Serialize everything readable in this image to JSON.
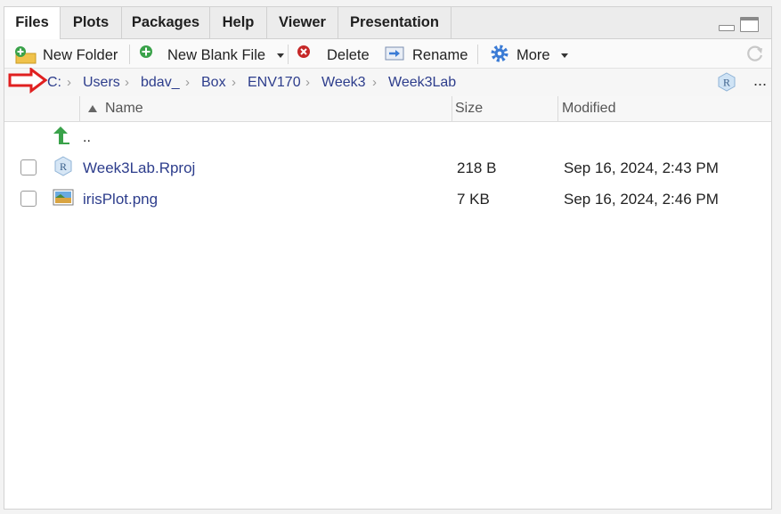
{
  "tabs": [
    {
      "label": "Files",
      "active": true
    },
    {
      "label": "Plots",
      "active": false
    },
    {
      "label": "Packages",
      "active": false
    },
    {
      "label": "Help",
      "active": false
    },
    {
      "label": "Viewer",
      "active": false
    },
    {
      "label": "Presentation",
      "active": false
    }
  ],
  "toolbar": {
    "new_folder": "New Folder",
    "new_blank_file": "New Blank File",
    "delete": "Delete",
    "rename": "Rename",
    "more": "More"
  },
  "breadcrumb": [
    "C:",
    "Users",
    "bdav_",
    "Box",
    "ENV170",
    "Week3",
    "Week3Lab"
  ],
  "overflow_label": "...",
  "columns": {
    "name": "Name",
    "size": "Size",
    "modified": "Modified"
  },
  "parent_dir": "..",
  "files": [
    {
      "name": "Week3Lab.Rproj",
      "size": "218 B",
      "modified": "Sep 16, 2024, 2:43 PM",
      "icon": "rproj-icon"
    },
    {
      "name": "irisPlot.png",
      "size": "7 KB",
      "modified": "Sep 16, 2024, 2:46 PM",
      "icon": "image-file-icon"
    }
  ],
  "colors": {
    "link": "#2d3d8c",
    "annotation_arrow": "#e02020",
    "add_icon": "#3aa24a",
    "delete_icon": "#c62828",
    "gear_icon": "#3a7bd5"
  }
}
